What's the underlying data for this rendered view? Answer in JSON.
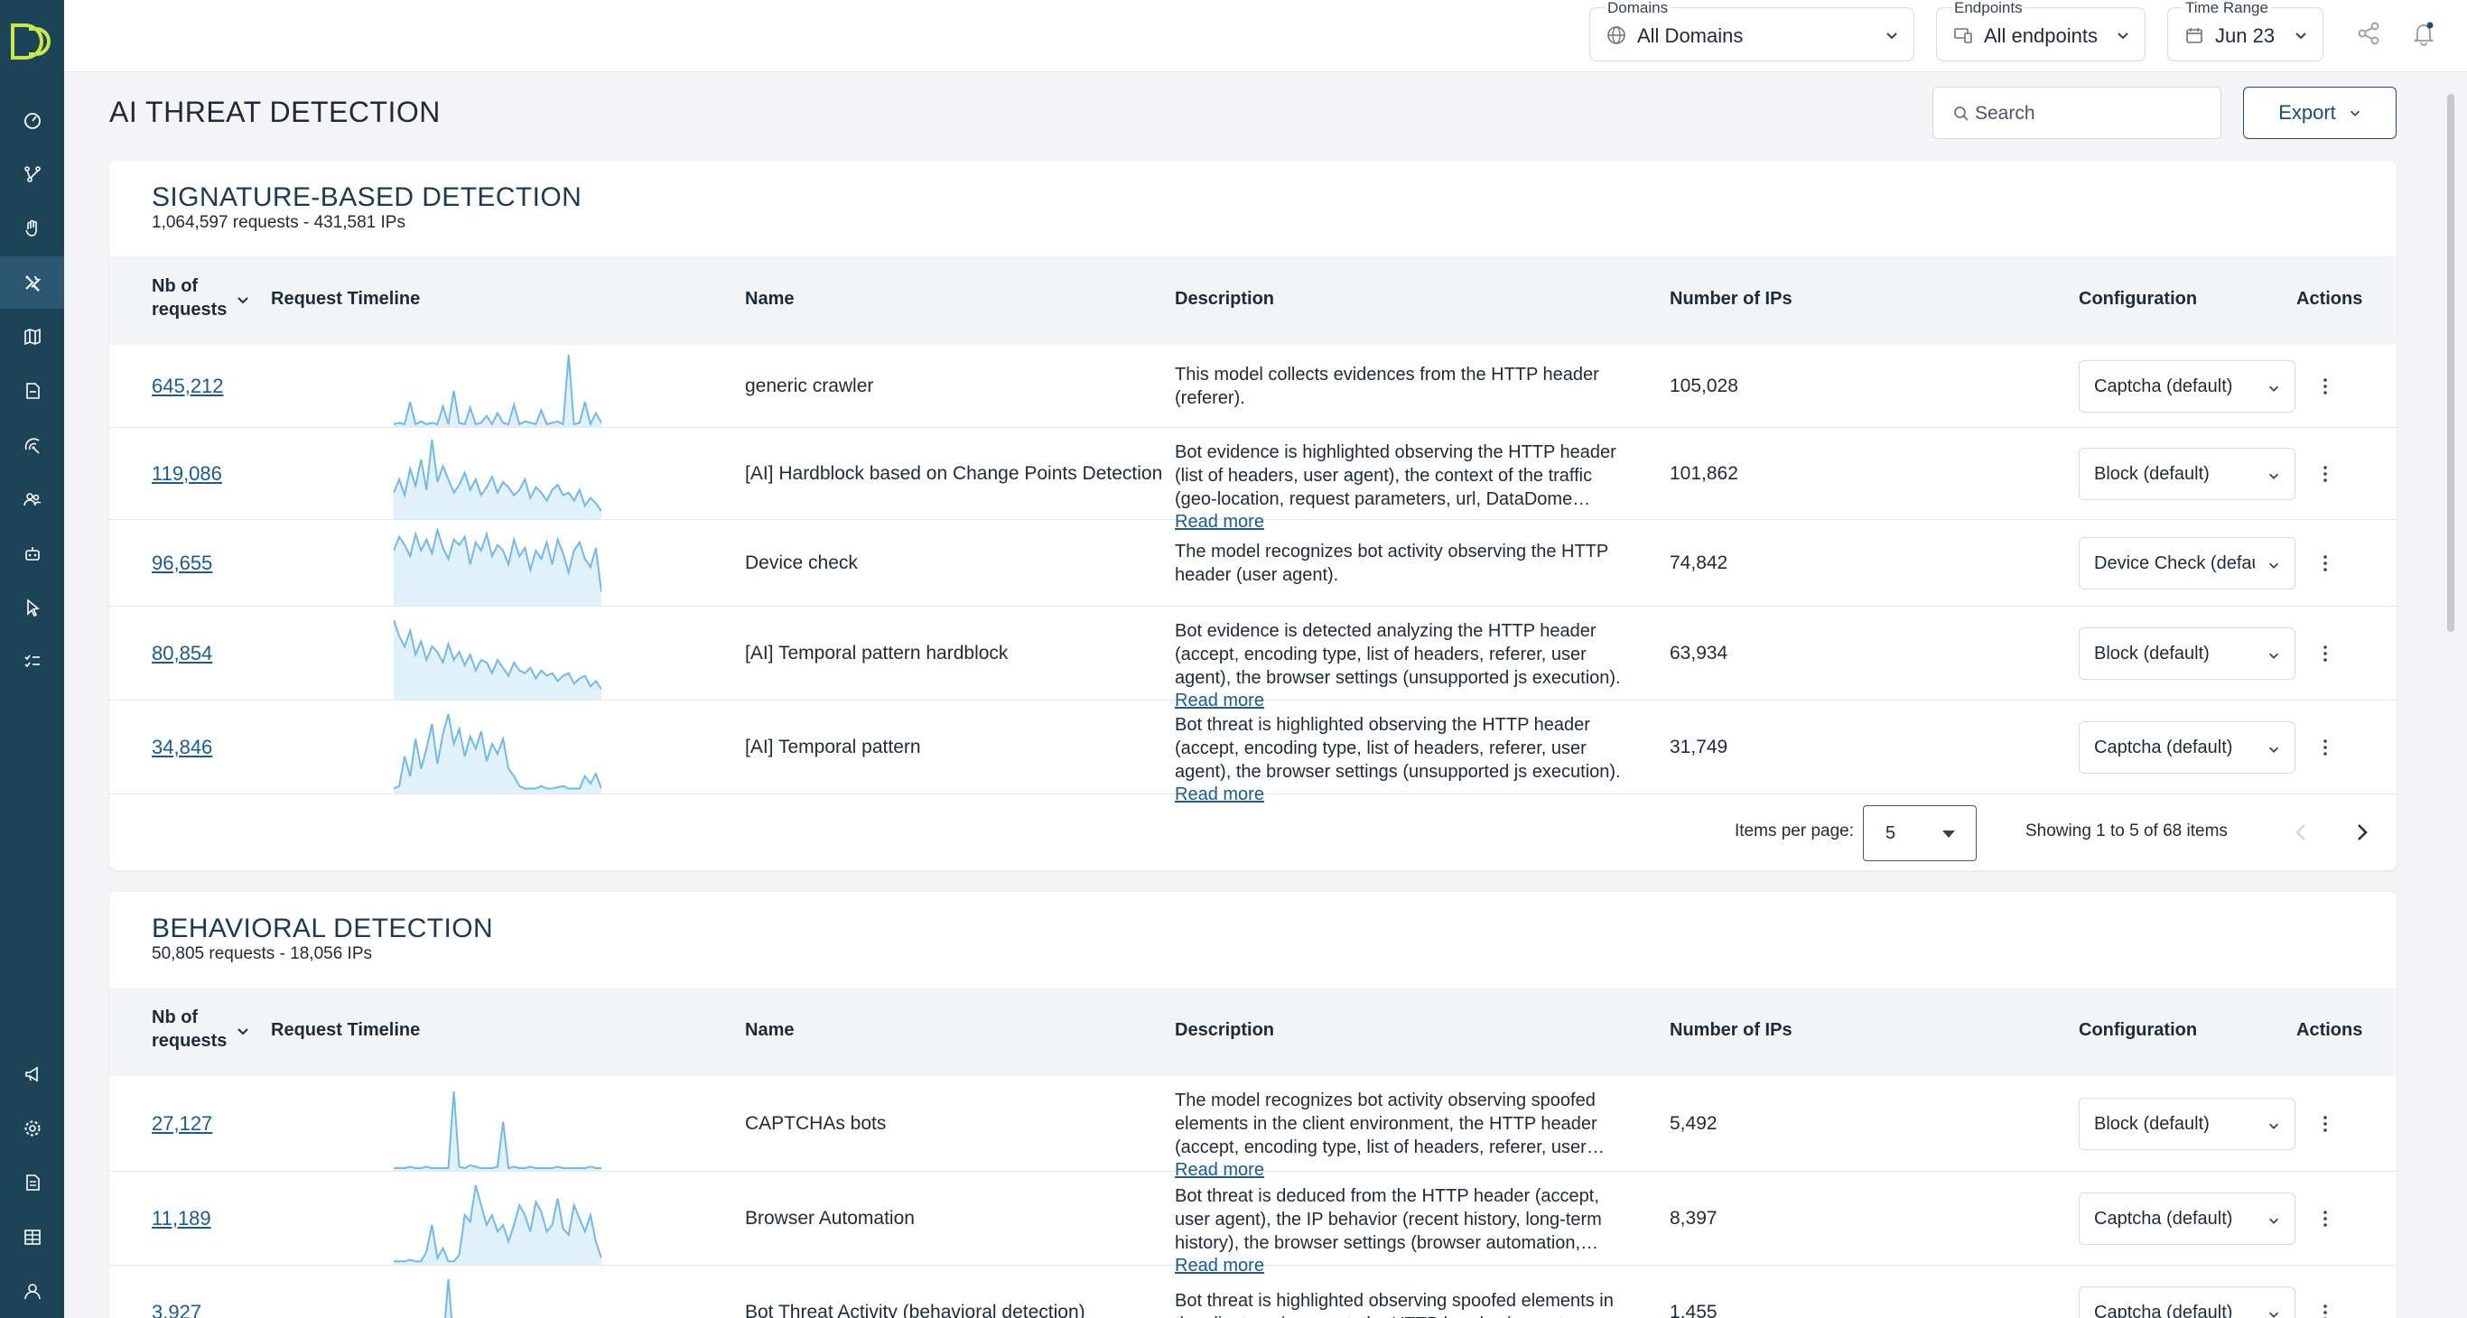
{
  "colors": {
    "sidebar": "#1d4357",
    "accent": "#1d5a85",
    "logo": "#c8e64d",
    "spark": "#73b8e6"
  },
  "nav": {
    "top_icons": [
      "dashboard-icon",
      "flow-icon",
      "hand-icon",
      "tools-icon",
      "map-icon",
      "report-icon",
      "radar-icon",
      "users-icon",
      "robot-icon",
      "pointer-icon",
      "checklist-icon"
    ],
    "active_index": 3,
    "bottom_icons": [
      "megaphone-icon",
      "settings-icon",
      "document-icon",
      "building-icon",
      "account-icon"
    ]
  },
  "topbar": {
    "domains": {
      "label": "Domains",
      "value": "All Domains"
    },
    "endpoints": {
      "label": "Endpoints",
      "value": "All endpoints"
    },
    "time_range": {
      "label": "Time Range",
      "value": "Jun 23"
    }
  },
  "page": {
    "title": "AI THREAT DETECTION",
    "search_placeholder": "Search",
    "export_label": "Export"
  },
  "columns": {
    "nb": [
      "Nb of",
      "requests"
    ],
    "timeline": "Request Timeline",
    "name": "Name",
    "description": "Description",
    "ips": "Number of IPs",
    "configuration": "Configuration",
    "actions": "Actions"
  },
  "signature": {
    "title": "SIGNATURE-BASED DETECTION",
    "subtitle": "1,064,597 requests - 431,581 IPs",
    "rows": [
      {
        "requests": "645,212",
        "name": "generic crawler",
        "description": "This model collects evidences from the HTTP header (referer).",
        "read_more": "",
        "ips": "105,028",
        "config": "Captcha (default)"
      },
      {
        "requests": "119,086",
        "name": "[AI] Hardblock based on Change Points Detection",
        "description": "Bot evidence is highlighted observing the HTTP header (list of headers, user agent), the context of the traffic (geo-location, request parameters, url, DataDome cookie).",
        "read_more": "Read more",
        "ips": "101,862",
        "config": "Block (default)"
      },
      {
        "requests": "96,655",
        "name": "Device check",
        "description": "The model recognizes bot activity observing the HTTP header (user agent).",
        "read_more": "",
        "ips": "74,842",
        "config": "Device Check (default)"
      },
      {
        "requests": "80,854",
        "name": "[AI] Temporal pattern hardblock",
        "description": "Bot evidence is detected analyzing the HTTP header (accept, encoding type, list of headers, referer, user agent), the browser settings (unsupported js execution).",
        "read_more": "Read more",
        "ips": "63,934",
        "config": "Block (default)"
      },
      {
        "requests": "34,846",
        "name": "[AI] Temporal pattern",
        "description": "Bot threat is highlighted observing the HTTP header (accept, encoding type, list of headers, referer, user agent), the browser settings (unsupported js execution).",
        "read_more": "Read more",
        "ips": "31,749",
        "config": "Captcha (default)"
      }
    ],
    "pager": {
      "items_per_page_label": "Items per page:",
      "items_per_page": "5",
      "showing": "Showing 1 to 5 of 68 items"
    }
  },
  "behavioral": {
    "title": "BEHAVIORAL DETECTION",
    "subtitle": "50,805 requests - 18,056 IPs",
    "rows": [
      {
        "requests": "27,127",
        "name": "CAPTCHAs bots",
        "description": "The model recognizes bot activity observing spoofed elements in the client environment, the HTTP header (accept, encoding type, list of headers, referer, user agent).",
        "read_more": "Read more",
        "ips": "5,492",
        "config": "Block (default)"
      },
      {
        "requests": "11,189",
        "name": "Browser Automation",
        "description": "Bot threat is deduced from the HTTP header (accept, user agent), the IP behavior (recent history, long-term history), the browser settings (browser automation, unsupported js).",
        "read_more": "Read more",
        "ips": "8,397",
        "config": "Captcha (default)"
      },
      {
        "requests": "3,927",
        "name": "Bot Threat Activity (behavioral detection)",
        "description": "Bot threat is highlighted observing spoofed elements in the client environment, the HTTP header (accept, encoding type).",
        "read_more": "",
        "ips": "1,455",
        "config": "Captcha (default)"
      }
    ]
  },
  "sparklines": {
    "sig_0": [
      2,
      3,
      2,
      18,
      2,
      4,
      2,
      3,
      2,
      15,
      2,
      26,
      3,
      2,
      14,
      2,
      3,
      8,
      2,
      10,
      3,
      2,
      16,
      2,
      4,
      3,
      2,
      12,
      2,
      3,
      4,
      2,
      52,
      2,
      3,
      18,
      2,
      10,
      3
    ],
    "sig_1": [
      20,
      30,
      18,
      38,
      25,
      45,
      22,
      60,
      28,
      40,
      30,
      20,
      26,
      35,
      22,
      30,
      18,
      24,
      32,
      20,
      28,
      24,
      18,
      22,
      30,
      16,
      24,
      20,
      14,
      22,
      26,
      18,
      20,
      14,
      22,
      10,
      16,
      12,
      6
    ],
    "sig_2": [
      40,
      50,
      44,
      36,
      52,
      40,
      48,
      38,
      55,
      42,
      34,
      48,
      44,
      50,
      30,
      46,
      40,
      52,
      36,
      44,
      40,
      30,
      48,
      36,
      42,
      26,
      40,
      34,
      46,
      30,
      48,
      38,
      24,
      40,
      46,
      34,
      28,
      42,
      10
    ],
    "sig_3": [
      60,
      48,
      40,
      52,
      34,
      44,
      30,
      40,
      36,
      28,
      42,
      30,
      36,
      26,
      34,
      22,
      30,
      28,
      20,
      30,
      24,
      18,
      28,
      22,
      20,
      24,
      16,
      22,
      18,
      20,
      14,
      18,
      20,
      12,
      16,
      18,
      10,
      14,
      8
    ],
    "sig_4": [
      4,
      6,
      30,
      14,
      44,
      20,
      36,
      56,
      24,
      48,
      64,
      40,
      52,
      30,
      46,
      36,
      50,
      26,
      40,
      32,
      44,
      20,
      14,
      6,
      4,
      4,
      4,
      6,
      4,
      4,
      5,
      6,
      4,
      4,
      4,
      14,
      8,
      16,
      4
    ],
    "beh_0": [
      2,
      2,
      2,
      3,
      2,
      2,
      3,
      2,
      2,
      2,
      2,
      58,
      3,
      2,
      4,
      3,
      2,
      2,
      2,
      3,
      36,
      2,
      3,
      2,
      2,
      3,
      2,
      2,
      2,
      2,
      3,
      2,
      2,
      2,
      2,
      2,
      3,
      2,
      2
    ],
    "beh_1": [
      2,
      2,
      2,
      3,
      2,
      2,
      8,
      24,
      4,
      10,
      2,
      2,
      6,
      30,
      26,
      48,
      36,
      24,
      30,
      20,
      24,
      14,
      24,
      36,
      30,
      20,
      38,
      32,
      20,
      24,
      40,
      22,
      18,
      36,
      28,
      20,
      30,
      14,
      4
    ],
    "beh_2": [
      2,
      2,
      3,
      2,
      2,
      3,
      2,
      4,
      10,
      3,
      22,
      4,
      2,
      3,
      2,
      2,
      3,
      2,
      2,
      2,
      3,
      2,
      2,
      2,
      3,
      2,
      2,
      2,
      2,
      3,
      2,
      2,
      2,
      2,
      2,
      3,
      2,
      2,
      2
    ]
  }
}
